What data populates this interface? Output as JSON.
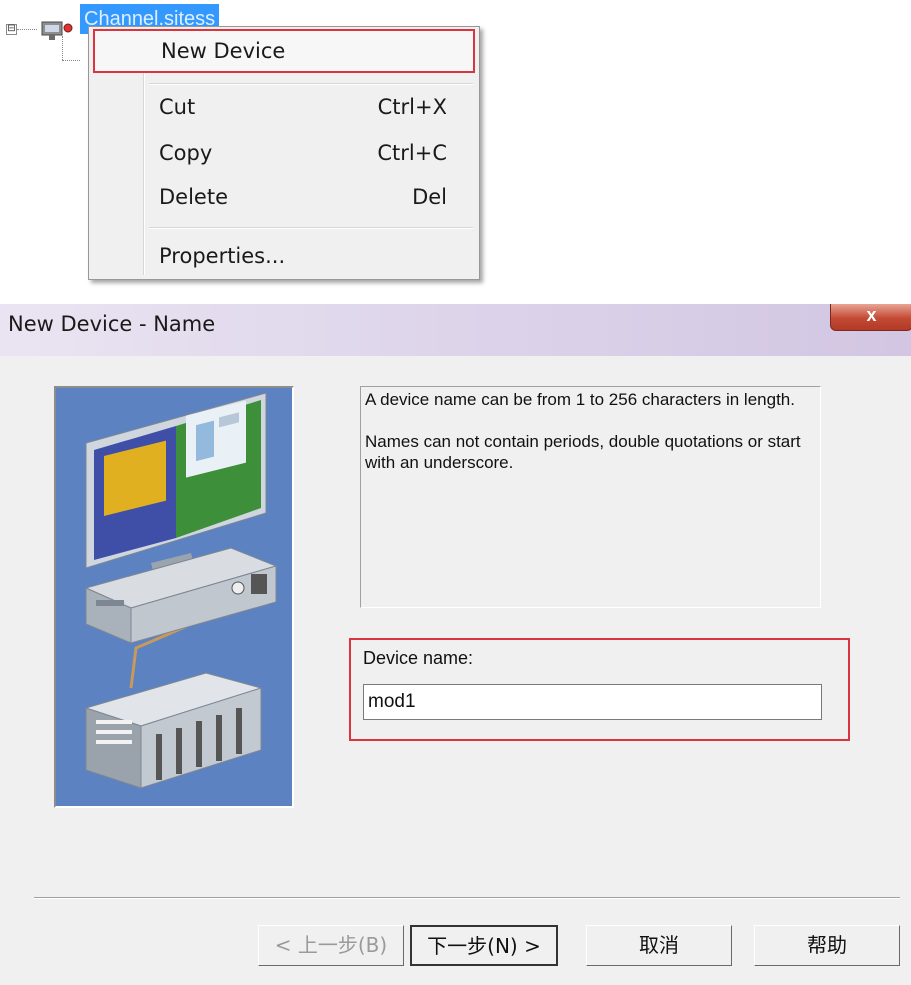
{
  "tree": {
    "expander": "⊟",
    "channel_label": "Channel.sitess"
  },
  "context_menu": {
    "items": [
      {
        "label": "New Device",
        "shortcut": ""
      },
      {
        "label": "Cut",
        "shortcut": "Ctrl+X"
      },
      {
        "label": "Copy",
        "shortcut": "Ctrl+C"
      },
      {
        "label": "Delete",
        "shortcut": "Del"
      },
      {
        "label": "Properties...",
        "shortcut": ""
      }
    ],
    "highlight_color": "#d9343f"
  },
  "dialog": {
    "title": "New Device - Name",
    "close_label": "x",
    "info_lines": [
      "A device name can be from 1 to 256 characters in length.",
      "Names can not contain periods, double quotations or start with an underscore."
    ],
    "device_name_label": "Device name:",
    "device_name_value": "mod1",
    "buttons": {
      "back": "< 上一步(B)",
      "next": "下一步(N) >",
      "cancel": "取消",
      "help": "帮助"
    }
  },
  "colors": {
    "selection": "#3399ff",
    "art_background": "#5d82c2",
    "titlebar": "#ddd4ea",
    "close_button": "#c34a34"
  }
}
